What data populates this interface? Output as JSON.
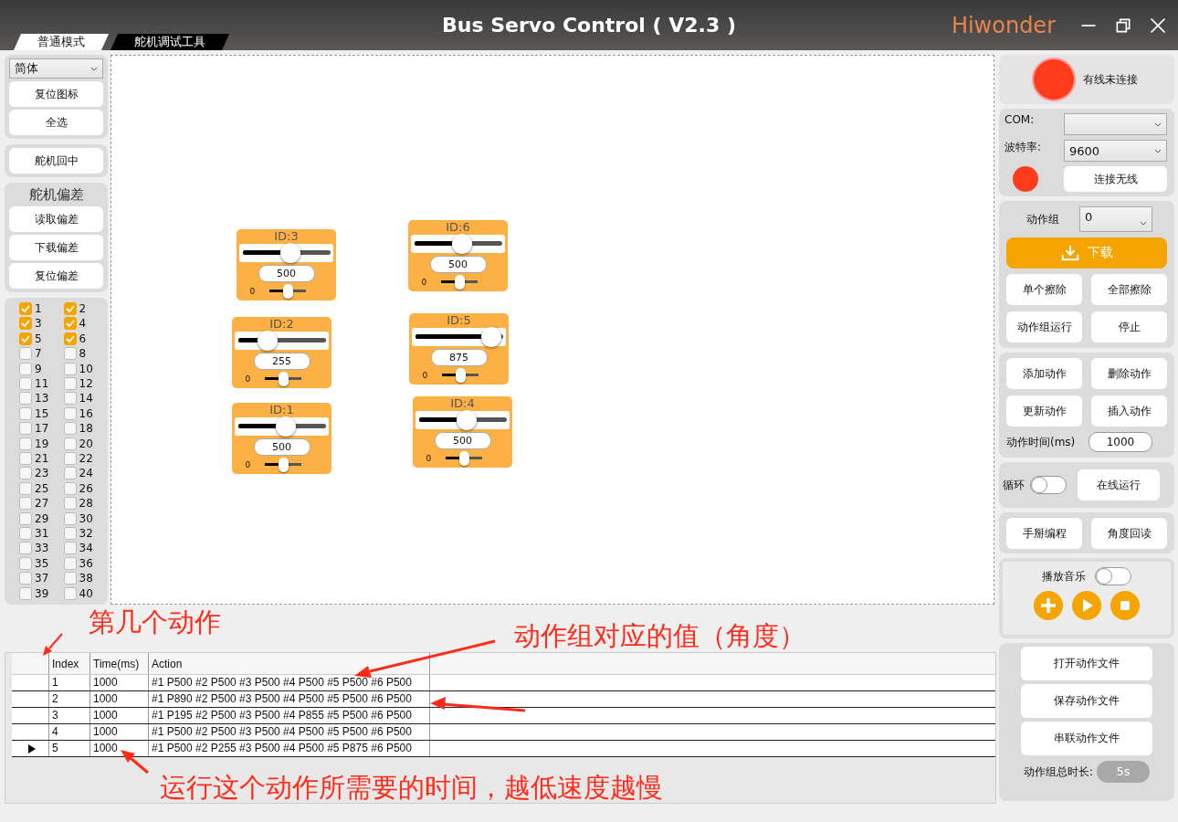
{
  "window": {
    "title": "Bus Servo Control ( V2.3 )",
    "logo": "Hiwonder"
  },
  "tabs": [
    {
      "label": "普通模式",
      "selected": true
    },
    {
      "label": "舵机调试工具",
      "selected": false
    }
  ],
  "left_panel": {
    "language": "简体",
    "buttons": [
      "复位图标",
      "全选"
    ],
    "center_button": "舵机回中",
    "offset_group": {
      "title": "舵机偏差",
      "buttons": [
        "读取偏差",
        "下载偏差",
        "复位偏差"
      ]
    },
    "servo_checkboxes": [
      {
        "label": "1",
        "checked": true
      },
      {
        "label": "2",
        "checked": true
      },
      {
        "label": "3",
        "checked": true
      },
      {
        "label": "4",
        "checked": true
      },
      {
        "label": "5",
        "checked": true
      },
      {
        "label": "6",
        "checked": true
      },
      {
        "label": "7",
        "checked": false
      },
      {
        "label": "8",
        "checked": false
      },
      {
        "label": "9",
        "checked": false
      },
      {
        "label": "10",
        "checked": false
      },
      {
        "label": "11",
        "checked": false
      },
      {
        "label": "12",
        "checked": false
      },
      {
        "label": "13",
        "checked": false
      },
      {
        "label": "14",
        "checked": false
      },
      {
        "label": "15",
        "checked": false
      },
      {
        "label": "16",
        "checked": false
      },
      {
        "label": "17",
        "checked": false
      },
      {
        "label": "18",
        "checked": false
      },
      {
        "label": "19",
        "checked": false
      },
      {
        "label": "20",
        "checked": false
      },
      {
        "label": "21",
        "checked": false
      },
      {
        "label": "22",
        "checked": false
      },
      {
        "label": "23",
        "checked": false
      },
      {
        "label": "24",
        "checked": false
      },
      {
        "label": "25",
        "checked": false
      },
      {
        "label": "26",
        "checked": false
      },
      {
        "label": "27",
        "checked": false
      },
      {
        "label": "28",
        "checked": false
      },
      {
        "label": "29",
        "checked": false
      },
      {
        "label": "30",
        "checked": false
      },
      {
        "label": "31",
        "checked": false
      },
      {
        "label": "32",
        "checked": false
      },
      {
        "label": "33",
        "checked": false
      },
      {
        "label": "34",
        "checked": false
      },
      {
        "label": "35",
        "checked": false
      },
      {
        "label": "36",
        "checked": false
      },
      {
        "label": "37",
        "checked": false
      },
      {
        "label": "38",
        "checked": false
      },
      {
        "label": "39",
        "checked": false
      },
      {
        "label": "40",
        "checked": false
      }
    ]
  },
  "servos": [
    {
      "id_label": "ID:3",
      "level": 0.5,
      "value": "500",
      "min_label": "0",
      "fine_slider": {
        "level": 0.5
      }
    },
    {
      "id_label": "ID:2",
      "level": 0.255,
      "value": "255",
      "min_label": "0",
      "fine_slider": {
        "level": 0.5
      }
    },
    {
      "id_label": "ID:1",
      "level": 0.5,
      "value": "500",
      "min_label": "0",
      "fine_slider": {
        "level": 0.5
      }
    },
    {
      "id_label": "ID:6",
      "level": 0.5,
      "value": "500",
      "min_label": "0",
      "fine_slider": {
        "level": 0.5
      }
    },
    {
      "id_label": "ID:5",
      "level": 0.875,
      "value": "875",
      "min_label": "0",
      "fine_slider": {
        "level": 0.5
      }
    },
    {
      "id_label": "ID:4",
      "level": 0.5,
      "value": "500",
      "min_label": "0",
      "fine_slider": {
        "level": 0.5
      }
    }
  ],
  "connection": {
    "connected": false,
    "status": "有线未连接",
    "com_label": "COM:",
    "baud_label": "波特率:",
    "baud": "9600",
    "wireless_connected": false,
    "wireless_button": "连接无线"
  },
  "action_group": {
    "label": "动作组",
    "value": "0",
    "download": "下载",
    "buttons": [
      "单个擦除",
      "全部擦除",
      "动作组运行",
      "停止"
    ]
  },
  "action_edit": {
    "buttons": [
      "添加动作",
      "删除动作",
      "更新动作",
      "插入动作"
    ],
    "time_label": "动作时间(ms)",
    "time": "1000"
  },
  "loop": {
    "label": "循环",
    "on": false,
    "button": "在线运行"
  },
  "manual": {
    "buttons": [
      "手掰编程",
      "角度回读"
    ]
  },
  "music": {
    "label": "播放音乐",
    "on": false
  },
  "files": {
    "buttons": [
      "打开动作文件",
      "保存动作文件",
      "串联动作文件"
    ],
    "total_label": "动作组总时长:",
    "total": "5s"
  },
  "table": {
    "columns": [
      "Index",
      "Time(ms)",
      "Action"
    ],
    "rows": [
      {
        "index": "1",
        "time": "1000",
        "action": "#1 P500 #2 P500 #3 P500 #4 P500 #5 P500 #6 P500",
        "current": false
      },
      {
        "index": "2",
        "time": "1000",
        "action": "#1 P890 #2 P500 #3 P500 #4 P500 #5 P500 #6 P500",
        "current": false
      },
      {
        "index": "3",
        "time": "1000",
        "action": "#1 P195 #2 P500 #3 P500 #4 P855 #5 P500 #6 P500",
        "current": false
      },
      {
        "index": "4",
        "time": "1000",
        "action": "#1 P500 #2 P500 #3 P500 #4 P500 #5 P500 #6 P500",
        "current": false
      },
      {
        "index": "5",
        "time": "1000",
        "action": "#1 P500 #2 P255 #3 P500 #4 P500 #5 P875 #6 P500",
        "current": true
      }
    ]
  },
  "annotations": [
    "第几个动作",
    "动作组对应的值（角度）",
    "运行这个动作所需要的时间，越低速度越慢"
  ]
}
